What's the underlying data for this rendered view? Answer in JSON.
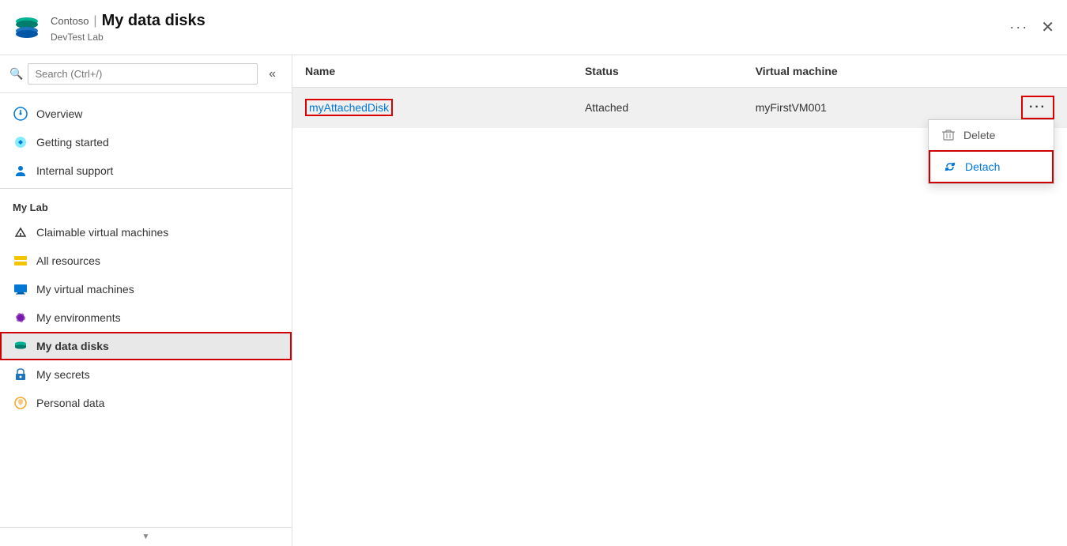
{
  "header": {
    "title": "My data disks",
    "breadcrumb": "Contoso",
    "separator": "|",
    "subtitle": "DevTest Lab",
    "more_label": "···",
    "close_label": "✕"
  },
  "sidebar": {
    "search_placeholder": "Search (Ctrl+/)",
    "collapse_label": "«",
    "nav_items": [
      {
        "id": "overview",
        "label": "Overview",
        "icon": "overview-icon"
      },
      {
        "id": "getting-started",
        "label": "Getting started",
        "icon": "getting-started-icon"
      },
      {
        "id": "internal-support",
        "label": "Internal support",
        "icon": "internal-support-icon"
      }
    ],
    "my_lab_section": "My Lab",
    "my_lab_items": [
      {
        "id": "claimable-vms",
        "label": "Claimable virtual machines",
        "icon": "claimable-icon"
      },
      {
        "id": "all-resources",
        "label": "All resources",
        "icon": "all-resources-icon"
      },
      {
        "id": "my-vms",
        "label": "My virtual machines",
        "icon": "my-vms-icon"
      },
      {
        "id": "my-environments",
        "label": "My environments",
        "icon": "my-environments-icon"
      },
      {
        "id": "my-data-disks",
        "label": "My data disks",
        "icon": "my-data-disks-icon",
        "active": true
      },
      {
        "id": "my-secrets",
        "label": "My secrets",
        "icon": "my-secrets-icon"
      },
      {
        "id": "personal-data",
        "label": "Personal data",
        "icon": "personal-data-icon"
      }
    ]
  },
  "table": {
    "columns": [
      {
        "id": "name",
        "label": "Name"
      },
      {
        "id": "status",
        "label": "Status"
      },
      {
        "id": "virtual_machine",
        "label": "Virtual machine"
      }
    ],
    "rows": [
      {
        "name": "myAttachedDisk",
        "status": "Attached",
        "virtual_machine": "myFirstVM001",
        "has_menu": true
      }
    ]
  },
  "context_menu": {
    "items": [
      {
        "id": "delete",
        "label": "Delete",
        "icon": "trash-icon"
      },
      {
        "id": "detach",
        "label": "Detach",
        "icon": "detach-icon",
        "highlighted": true
      }
    ]
  },
  "colors": {
    "accent": "#0078d4",
    "active_bg": "#e8e8e8",
    "highlight_border": "#cc0000",
    "header_border": "#e0e0e0"
  }
}
